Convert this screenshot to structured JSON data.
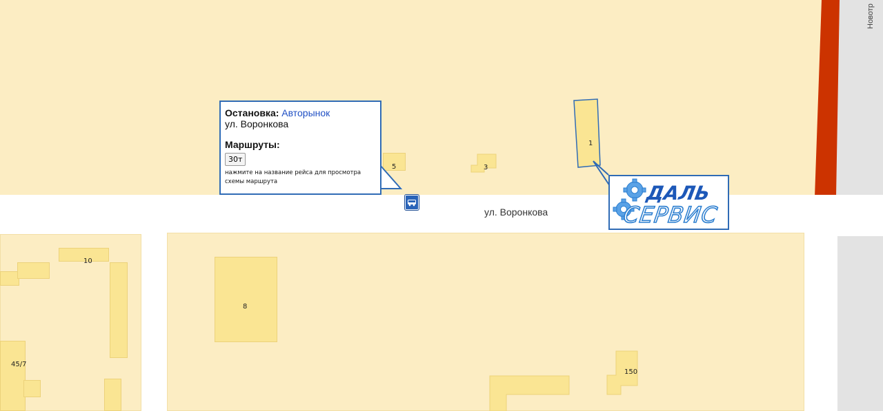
{
  "map": {
    "street_main": "ул. Воронкова",
    "street_vertical": "Новотр",
    "buildings": [
      "5",
      "3",
      "1",
      "10",
      "8",
      "45/7",
      "150"
    ]
  },
  "popup": {
    "stop_label": "Остановка:",
    "stop_name": "Авторынок",
    "stop_street": "ул. Воронкова",
    "routes_label": "Маршруты:",
    "route": "30т",
    "hint": "нажмите на название рейса для просмотра схемы маршрута"
  },
  "ad": {
    "logo_top": "ДАЛЬ",
    "logo_bottom": "СЕРВИС"
  },
  "colors": {
    "land": "#fcedc3",
    "building": "#fae593",
    "road": "#ffffff",
    "highway": "#cc3300",
    "popup_border": "#2f6bb5",
    "logo_blue": "#2d7fd0"
  },
  "icons": [
    "bus-stop-icon",
    "gear-icon"
  ]
}
